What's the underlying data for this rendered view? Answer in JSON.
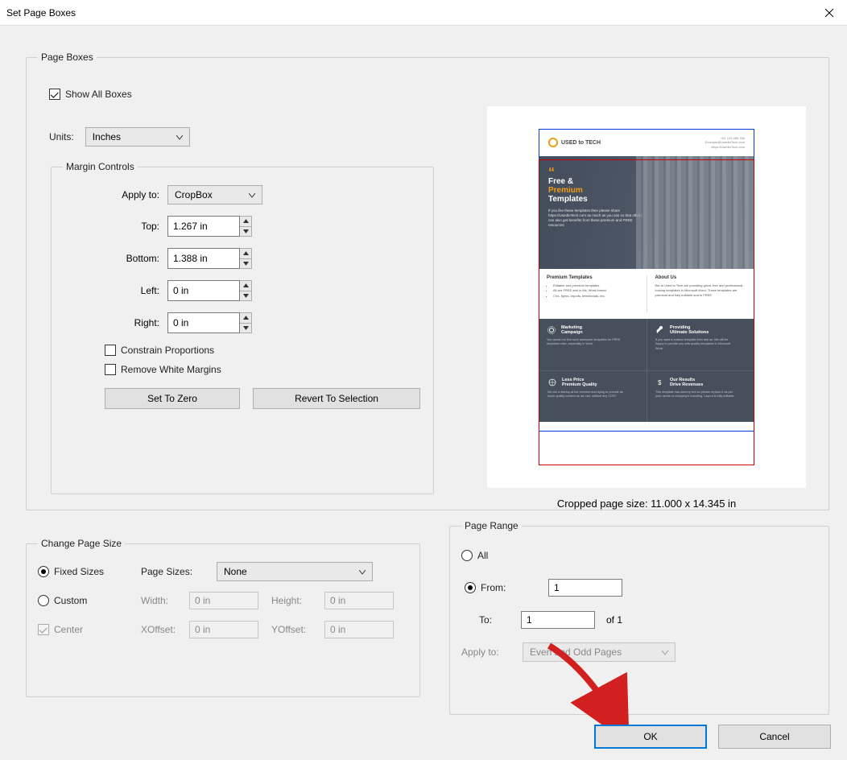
{
  "window": {
    "title": "Set Page Boxes"
  },
  "pageBoxes": {
    "legend": "Page Boxes",
    "showAll": {
      "label": "Show All Boxes",
      "checked": true
    },
    "units": {
      "label": "Units:",
      "value": "Inches"
    },
    "marginControls": {
      "legend": "Margin Controls",
      "applyTo": {
        "label": "Apply to:",
        "value": "CropBox"
      },
      "top": {
        "label": "Top:",
        "value": "1.267 in"
      },
      "bottom": {
        "label": "Bottom:",
        "value": "1.388 in"
      },
      "left": {
        "label": "Left:",
        "value": "0 in"
      },
      "right": {
        "label": "Right:",
        "value": "0 in"
      },
      "constrain": {
        "label": "Constrain Proportions",
        "checked": false
      },
      "removeWhite": {
        "label": "Remove White Margins",
        "checked": false
      },
      "setZero": "Set To Zero",
      "revert": "Revert To Selection"
    },
    "preview": {
      "flyer": {
        "brand": "USED to TECH",
        "contact_phone": "+61 123 456 789",
        "contact_email": "Example@UsedtoTech.com",
        "contact_url": "https://UsedtoTech.com",
        "hero_line1": "Free &",
        "hero_line2": "Premium",
        "hero_line3": "Templates",
        "hero_body": "If you like these templates then please share https://UsedtoTech.com as much as you can so that others can also get benefits from these premium and FREE resources",
        "mid_left_title": "Premium Templates",
        "mid_left_bullets": [
          "Editable and premium templates",
          "All are FREE and in Ms. Word format",
          "CVs, flyers, reports, letterheads, etc."
        ],
        "mid_right_title": "About Us",
        "mid_right_body": "We at Used to Tech are providing great, free and professional-looking templates in Microsoft Word. These templates are premium and fully editable and in FREE",
        "quad": [
          {
            "title1": "Marketing",
            "title2": "Campaign",
            "body": "You would not find such awesome templates for FREE anywhere else, especially in Word"
          },
          {
            "title1": "Providing",
            "title2": "Ultimate Solutions",
            "body": "If you want a custom template then ask us. We will be happy to provide you with quality templates in Microsoft Word"
          },
          {
            "title1": "Less Price",
            "title2": "Premium Quality",
            "body": "We are a startup at the moment and trying to provide as much quality content as we can, without any COST"
          },
          {
            "title1": "Our Results",
            "title2": "Drive Revenues",
            "body": "This template has dummy text so please replace it as per your needs or company's branding. Layout is fully editable"
          }
        ]
      },
      "cropSize": "Cropped page size: 11.000 x 14.345 in"
    }
  },
  "changePageSize": {
    "legend": "Change Page Size",
    "fixed": {
      "label": "Fixed Sizes",
      "checked": true
    },
    "custom": {
      "label": "Custom",
      "checked": false
    },
    "pageSizesLabel": "Page Sizes:",
    "pageSizesValue": "None",
    "widthLabel": "Width:",
    "widthValue": "0 in",
    "heightLabel": "Height:",
    "heightValue": "0 in",
    "centerLabel": "Center",
    "centerChecked": true,
    "xoffLabel": "XOffset:",
    "xoffValue": "0 in",
    "yoffLabel": "YOffset:",
    "yoffValue": "0 in"
  },
  "pageRange": {
    "legend": "Page Range",
    "all": {
      "label": "All",
      "checked": false
    },
    "from": {
      "label": "From:",
      "checked": true,
      "value": "1"
    },
    "to": {
      "label": "To:",
      "value": "1",
      "ofText": "of 1"
    },
    "applyTo": {
      "label": "Apply to:",
      "value": "Even and Odd Pages"
    }
  },
  "buttons": {
    "ok": "OK",
    "cancel": "Cancel"
  }
}
